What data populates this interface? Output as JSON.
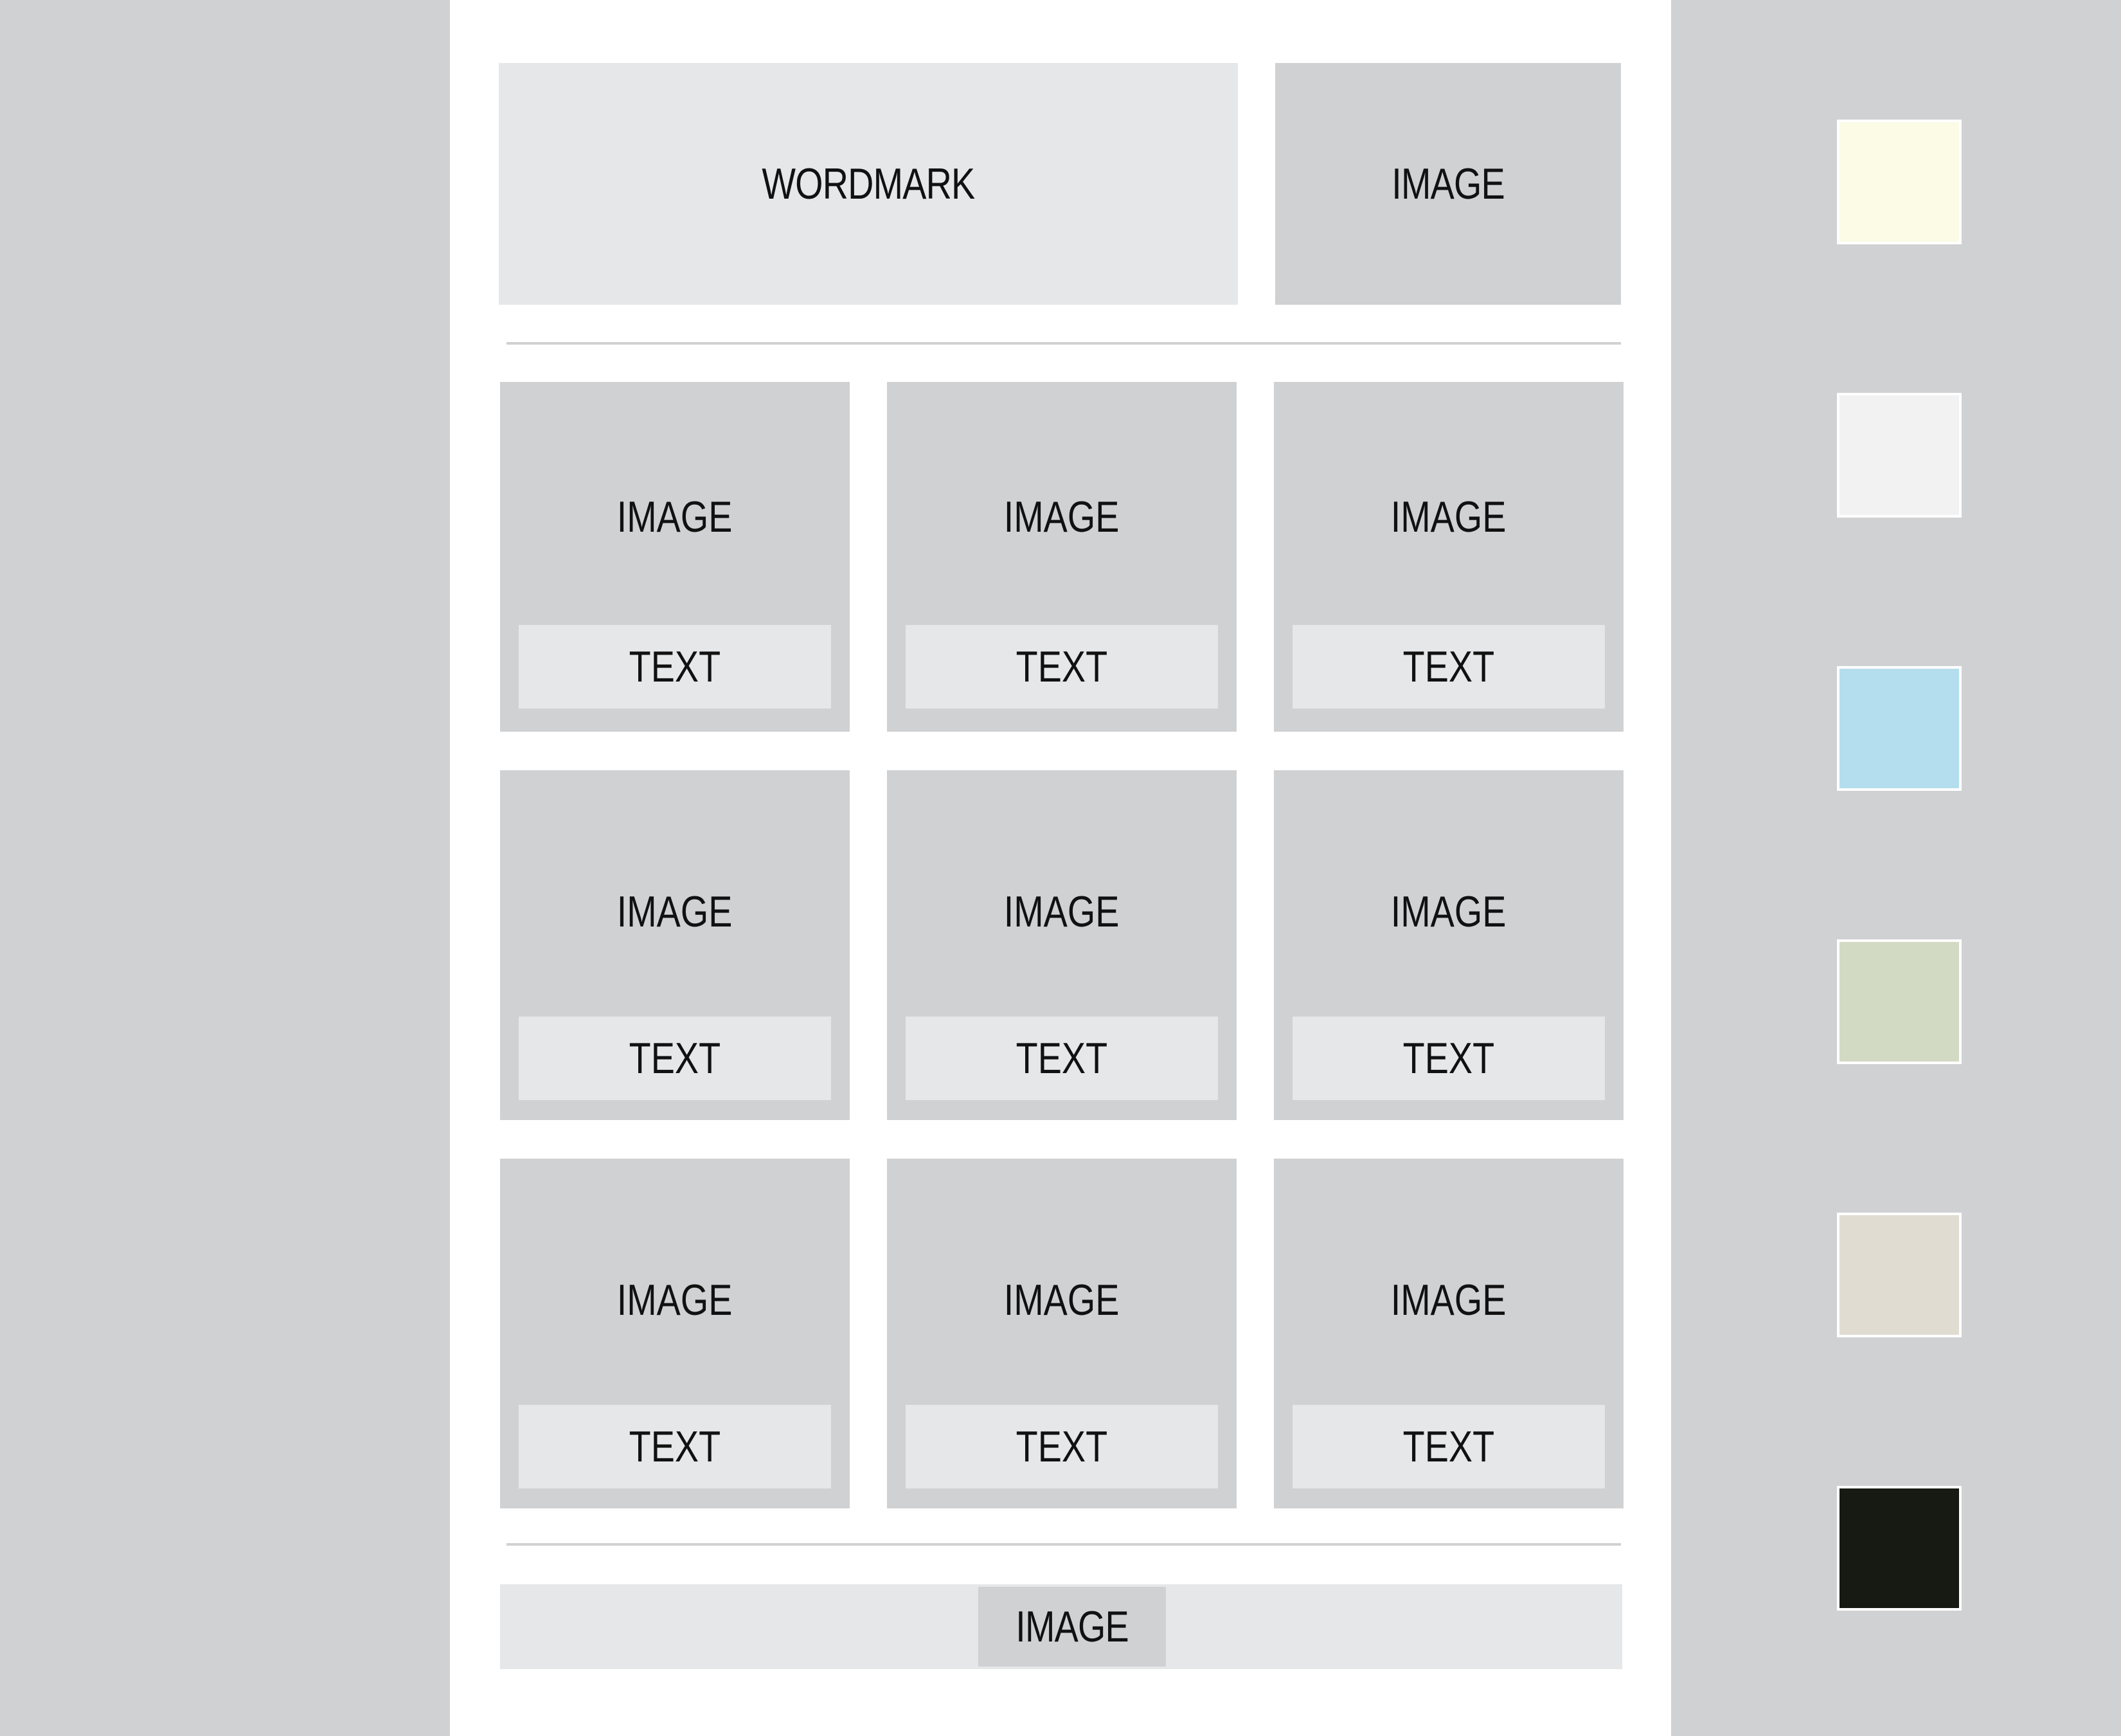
{
  "header": {
    "wordmark_label": "WORDMARK",
    "image_label": "IMAGE"
  },
  "grid": {
    "cards": [
      {
        "image_label": "IMAGE",
        "text_label": "TEXT"
      },
      {
        "image_label": "IMAGE",
        "text_label": "TEXT"
      },
      {
        "image_label": "IMAGE",
        "text_label": "TEXT"
      },
      {
        "image_label": "IMAGE",
        "text_label": "TEXT"
      },
      {
        "image_label": "IMAGE",
        "text_label": "TEXT"
      },
      {
        "image_label": "IMAGE",
        "text_label": "TEXT"
      },
      {
        "image_label": "IMAGE",
        "text_label": "TEXT"
      },
      {
        "image_label": "IMAGE",
        "text_label": "TEXT"
      },
      {
        "image_label": "IMAGE",
        "text_label": "TEXT"
      }
    ]
  },
  "footer": {
    "image_label": "IMAGE"
  },
  "palette": {
    "swatches": [
      {
        "color": "#fbfbe6"
      },
      {
        "color": "#f2f2f2"
      },
      {
        "color": "#b4deee"
      },
      {
        "color": "#d3dac3"
      },
      {
        "color": "#e1dcd2"
      },
      {
        "color": "#161a12"
      }
    ]
  },
  "colors": {
    "background": "#d0d1d3",
    "canvas": "#ffffff",
    "placeholder_light": "#e6e7e9",
    "placeholder_mid": "#d0d1d3",
    "text": "#111111"
  }
}
